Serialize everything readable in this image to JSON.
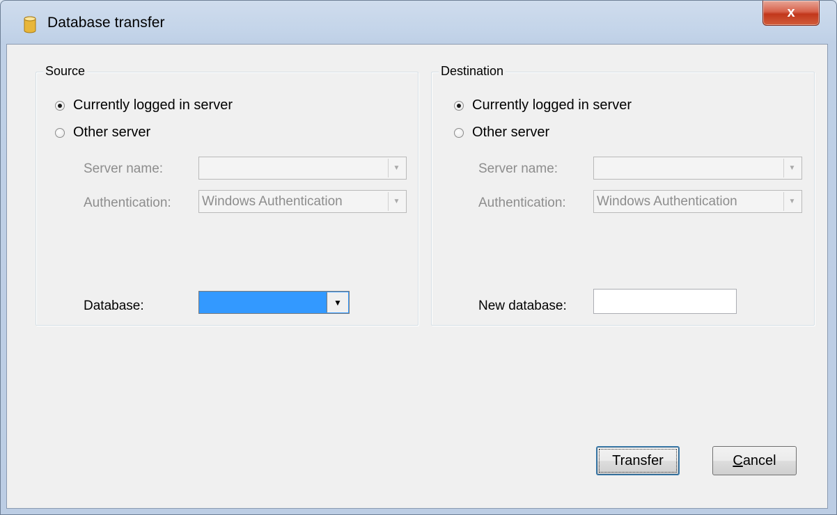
{
  "window": {
    "title": "Database transfer",
    "close_symbol": "x",
    "icon": "database-icon"
  },
  "source": {
    "legend": "Source",
    "radio_current": "Currently logged in server",
    "radio_other": "Other server",
    "selected": "current",
    "server_name_label": "Server name:",
    "server_name_value": "",
    "authentication_label": "Authentication:",
    "authentication_value": "Windows Authentication",
    "database_label": "Database:",
    "database_value": ""
  },
  "destination": {
    "legend": "Destination",
    "radio_current": "Currently logged in server",
    "radio_other": "Other server",
    "selected": "current",
    "server_name_label": "Server name:",
    "server_name_value": "",
    "authentication_label": "Authentication:",
    "authentication_value": "Windows Authentication",
    "new_database_label": "New database:",
    "new_database_value": ""
  },
  "buttons": {
    "transfer": "Transfer",
    "cancel_accel": "C",
    "cancel_rest": "ancel"
  },
  "colors": {
    "selection": "#3399ff",
    "dialog_bg": "#f0f0f0",
    "close_button": "#c2371c"
  }
}
